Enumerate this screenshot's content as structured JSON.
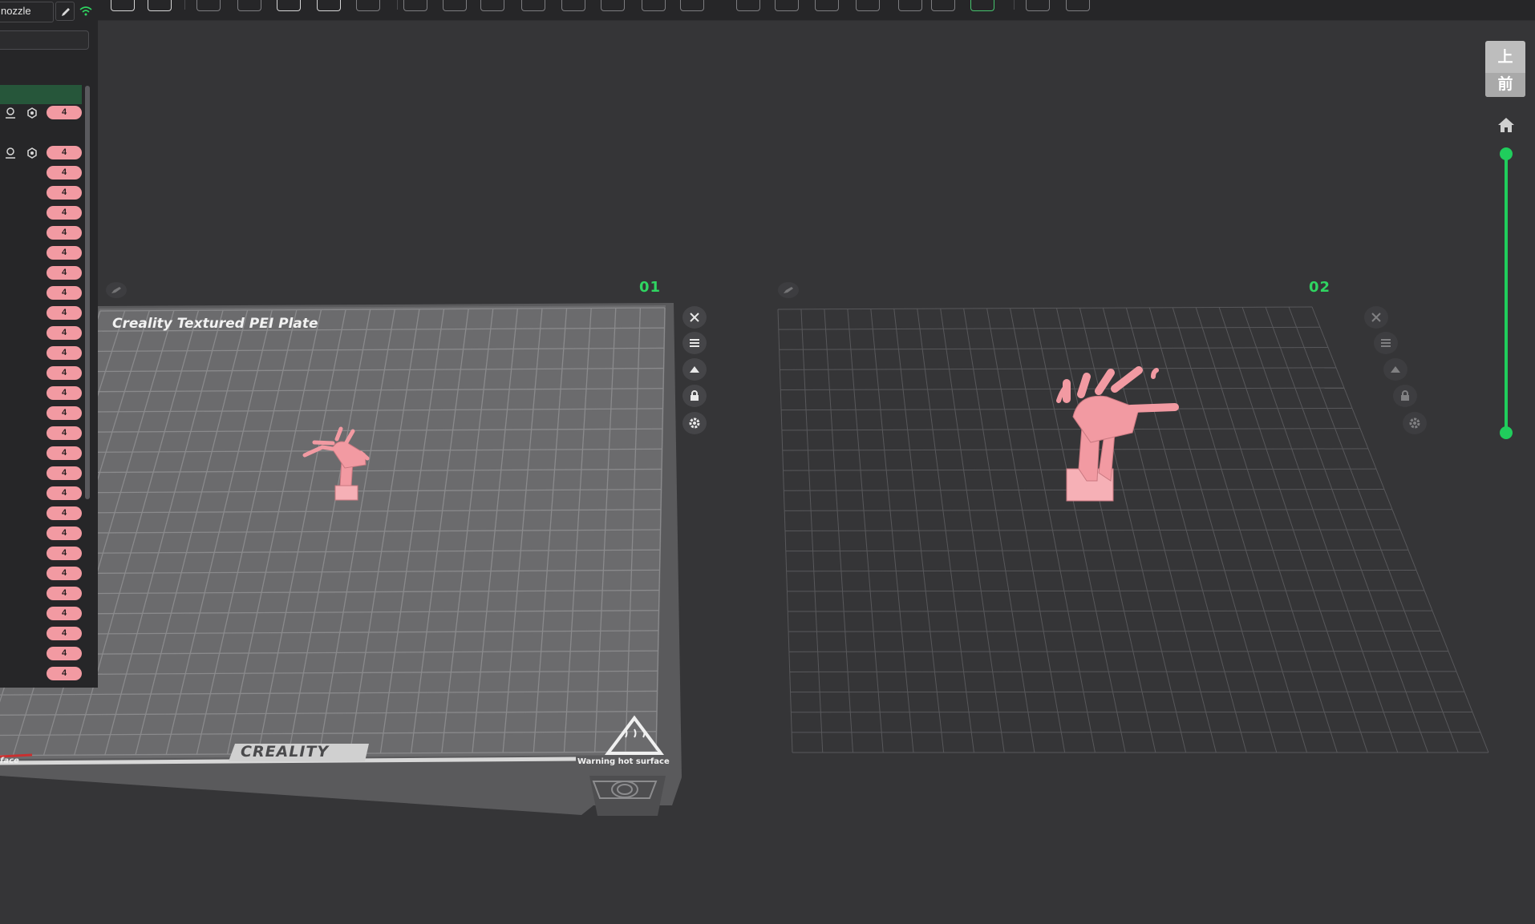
{
  "app": {
    "accent_color": "#20cd5c",
    "model_color": "#f29aa2"
  },
  "toolbar": {
    "icons": [
      "cube-view-icon",
      "grid-icon",
      "add-object-icon",
      "shield-icon",
      "auto-orient-icon",
      "arrange-icon",
      "lay-on-face-icon",
      "split-icon",
      "split-parts-icon",
      "measure-icon",
      "cut-icon",
      "move-icon",
      "rotate-icon",
      "scale-icon",
      "support-icon",
      "seam-icon",
      "variable-layer-icon",
      "brim-icon",
      "color-paint-icon",
      "fuzzy-icon",
      "connectors-icon",
      "text-icon",
      "export-icon",
      "shop-icon"
    ]
  },
  "left_panel": {
    "nozzle_label": "nozzle",
    "filter_placeholder": "",
    "row_badge": "4",
    "row_count": 28
  },
  "plates": [
    {
      "label": "01",
      "title": "Creality Textured PEI Plate"
    },
    {
      "label": "02",
      "title": ""
    }
  ],
  "bed": {
    "logo": "CREALITY",
    "warning": "Warning hot surface",
    "surface_text": "face"
  },
  "view_cube": {
    "top": "上",
    "front": "前"
  }
}
